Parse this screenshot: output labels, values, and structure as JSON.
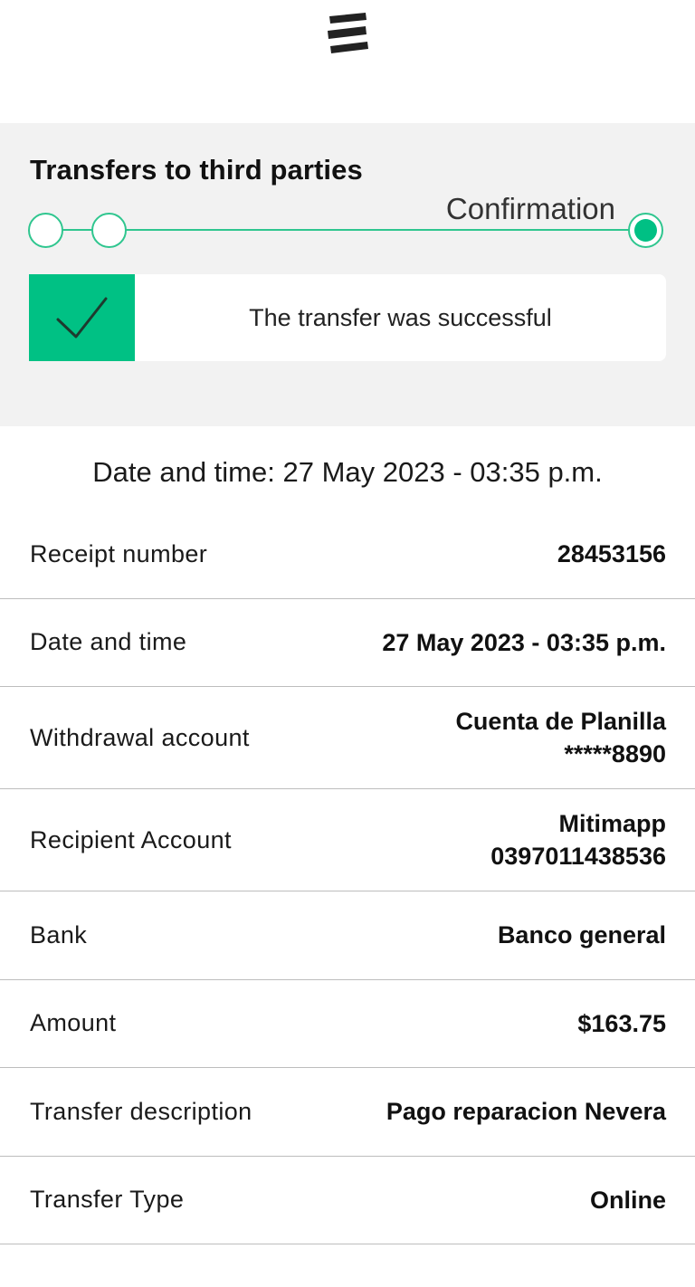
{
  "header": {
    "logo_icon": "bank-logo-icon"
  },
  "transfer": {
    "title": "Transfers to third parties",
    "step_label": "Confirmation",
    "steps_total": 3,
    "current_step": 3,
    "success_message": "The transfer was successful",
    "success_icon": "checkmark-icon"
  },
  "datetime_heading": "Date and time: 27 May 2023 - 03:35 p.m.",
  "details": [
    {
      "label": "Receipt number",
      "value": "28453156"
    },
    {
      "label": "Date and time",
      "value": "27 May 2023 - 03:35 p.m."
    },
    {
      "label": "Withdrawal account",
      "value_line1": "Cuenta de Planilla",
      "value_line2": "*****8890"
    },
    {
      "label": "Recipient Account",
      "value_line1": "Mitimapp",
      "value_line2": "0397011438536"
    },
    {
      "label": "Bank",
      "value": "Banco general"
    },
    {
      "label": "Amount",
      "value": "$163.75"
    },
    {
      "label": "Transfer description",
      "value": "Pago reparacion Nevera"
    },
    {
      "label": "Transfer Type",
      "value": "Online"
    }
  ],
  "colors": {
    "accent": "#00c184",
    "panel_bg": "#f2f2f2",
    "divider": "#bdbdbd"
  }
}
